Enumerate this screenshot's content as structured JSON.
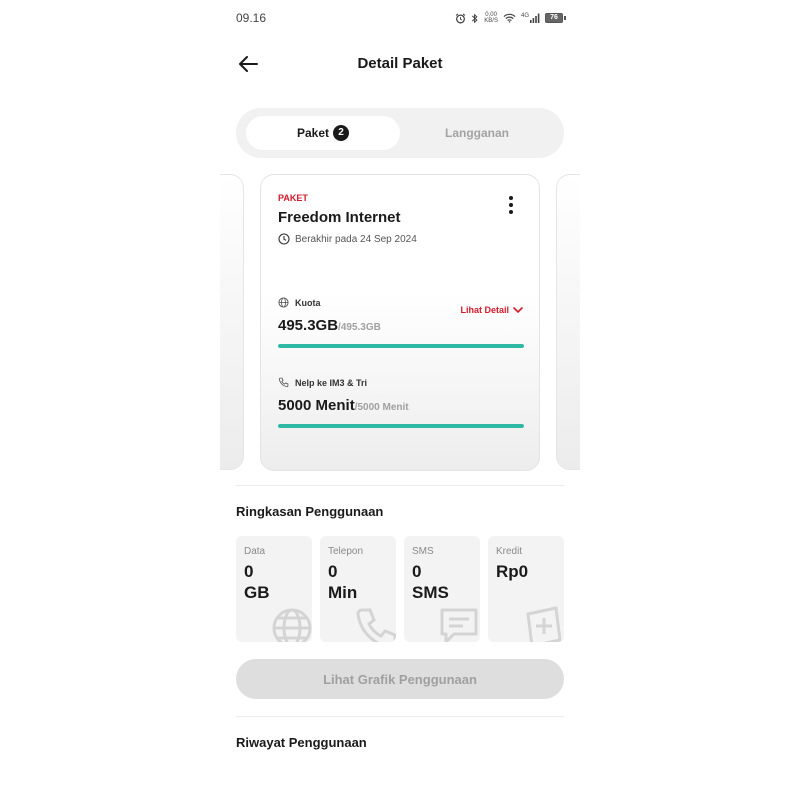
{
  "status_bar": {
    "time": "09.16",
    "net_speed_value": "0,00",
    "net_speed_unit": "KB/S",
    "network": "4G",
    "battery": "76"
  },
  "header": {
    "title": "Detail Paket"
  },
  "tabs": [
    {
      "label": "Paket",
      "badge": "2",
      "active": true
    },
    {
      "label": "Langganan",
      "active": false
    }
  ],
  "package_card": {
    "type_label": "PAKET",
    "name": "Freedom Internet",
    "expiry": "Berakhir pada 24 Sep 2024",
    "detail_link": "Lihat Detail",
    "quotas": [
      {
        "label": "Kuota",
        "icon": "globe-icon",
        "remaining": "495.3GB",
        "total": "/495.3GB",
        "fill_fraction": 1.0
      },
      {
        "label": "Nelp ke IM3 & Tri",
        "icon": "phone-icon",
        "remaining": "5000 Menit",
        "total": "/5000 Menit",
        "fill_fraction": 1.0
      }
    ]
  },
  "usage_summary": {
    "title": "Ringkasan Penggunaan",
    "cards": [
      {
        "label": "Data",
        "value_line1": "0",
        "value_line2": "GB",
        "icon": "globe-icon"
      },
      {
        "label": "Telepon",
        "value_line1": "0",
        "value_line2": "Min",
        "icon": "phone-icon"
      },
      {
        "label": "SMS",
        "value_line1": "0",
        "value_line2": "SMS",
        "icon": "message-icon"
      },
      {
        "label": "Kredit",
        "value_line1": "Rp0",
        "value_line2": "",
        "icon": "credit-icon"
      }
    ],
    "graph_button": "Lihat Grafik Penggunaan"
  },
  "history": {
    "title": "Riwayat Penggunaan"
  },
  "colors": {
    "accent_red": "#d8182b",
    "progress_teal": "#2fb9a5",
    "text_dark": "#1a1a1a",
    "muted": "#a0a0a0"
  }
}
